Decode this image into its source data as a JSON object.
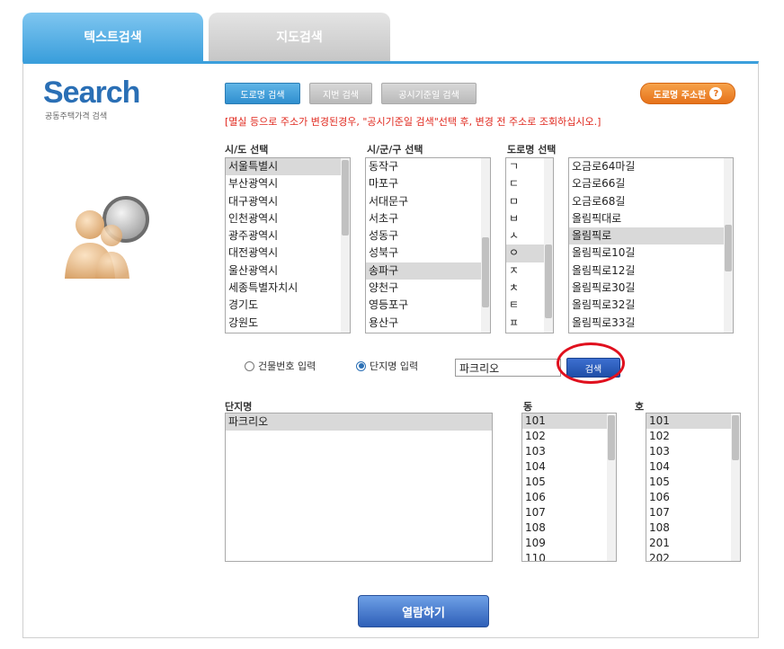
{
  "tabs": {
    "text_search": "텍스트검색",
    "map_search": "지도검색"
  },
  "logo": {
    "title": "Search",
    "subtitle": "공동주택가격 검색"
  },
  "search_mode_buttons": {
    "road_name": "도로명 검색",
    "lot_number": "지번 검색",
    "announce_date": "공시기준일 검색"
  },
  "guide_button": "도로명 주소란",
  "notice": "[멸실 등으로 주소가 변경된경우, \"공시기준일 검색\"선택 후, 변경 전 주소로 조회하십시오.]",
  "sido": {
    "label": "시/도 선택",
    "items": [
      "서울특별시",
      "부산광역시",
      "대구광역시",
      "인천광역시",
      "광주광역시",
      "대전광역시",
      "울산광역시",
      "세종특별자치시",
      "경기도",
      "강원도"
    ],
    "selected_index": 0
  },
  "sigungu": {
    "label": "시/군/구 선택",
    "items": [
      "동작구",
      "마포구",
      "서대문구",
      "서초구",
      "성동구",
      "성북구",
      "송파구",
      "양천구",
      "영등포구",
      "용산구"
    ],
    "selected_index": 6
  },
  "road": {
    "label": "도로명 선택",
    "initials": [
      "ㄱ",
      "ㄷ",
      "ㅁ",
      "ㅂ",
      "ㅅ",
      "ㅇ",
      "ㅈ",
      "ㅊ",
      "ㅌ",
      "ㅍ"
    ],
    "initial_selected_index": 5,
    "items": [
      "오금로64마길",
      "오금로66길",
      "오금로68길",
      "올림픽대로",
      "올림픽로",
      "올림픽로10길",
      "올림픽로12길",
      "올림픽로30길",
      "올림픽로32길",
      "올림픽로33길"
    ],
    "selected_index": 4
  },
  "input_mode": {
    "building_number": "건물번호 입력",
    "complex_name": "단지명 입력",
    "selected": "complex_name"
  },
  "complex_input_value": "파크리오",
  "search_button": "검색",
  "complex": {
    "label": "단지명",
    "items": [
      "파크리오"
    ],
    "selected_index": 0
  },
  "dong": {
    "label": "동",
    "items": [
      "101",
      "102",
      "103",
      "104",
      "105",
      "106",
      "107",
      "108",
      "109",
      "110"
    ],
    "selected_index": 0
  },
  "ho": {
    "label": "호",
    "items": [
      "101",
      "102",
      "103",
      "104",
      "105",
      "106",
      "107",
      "108",
      "201",
      "202"
    ],
    "selected_index": 0
  },
  "view_button": "열람하기"
}
